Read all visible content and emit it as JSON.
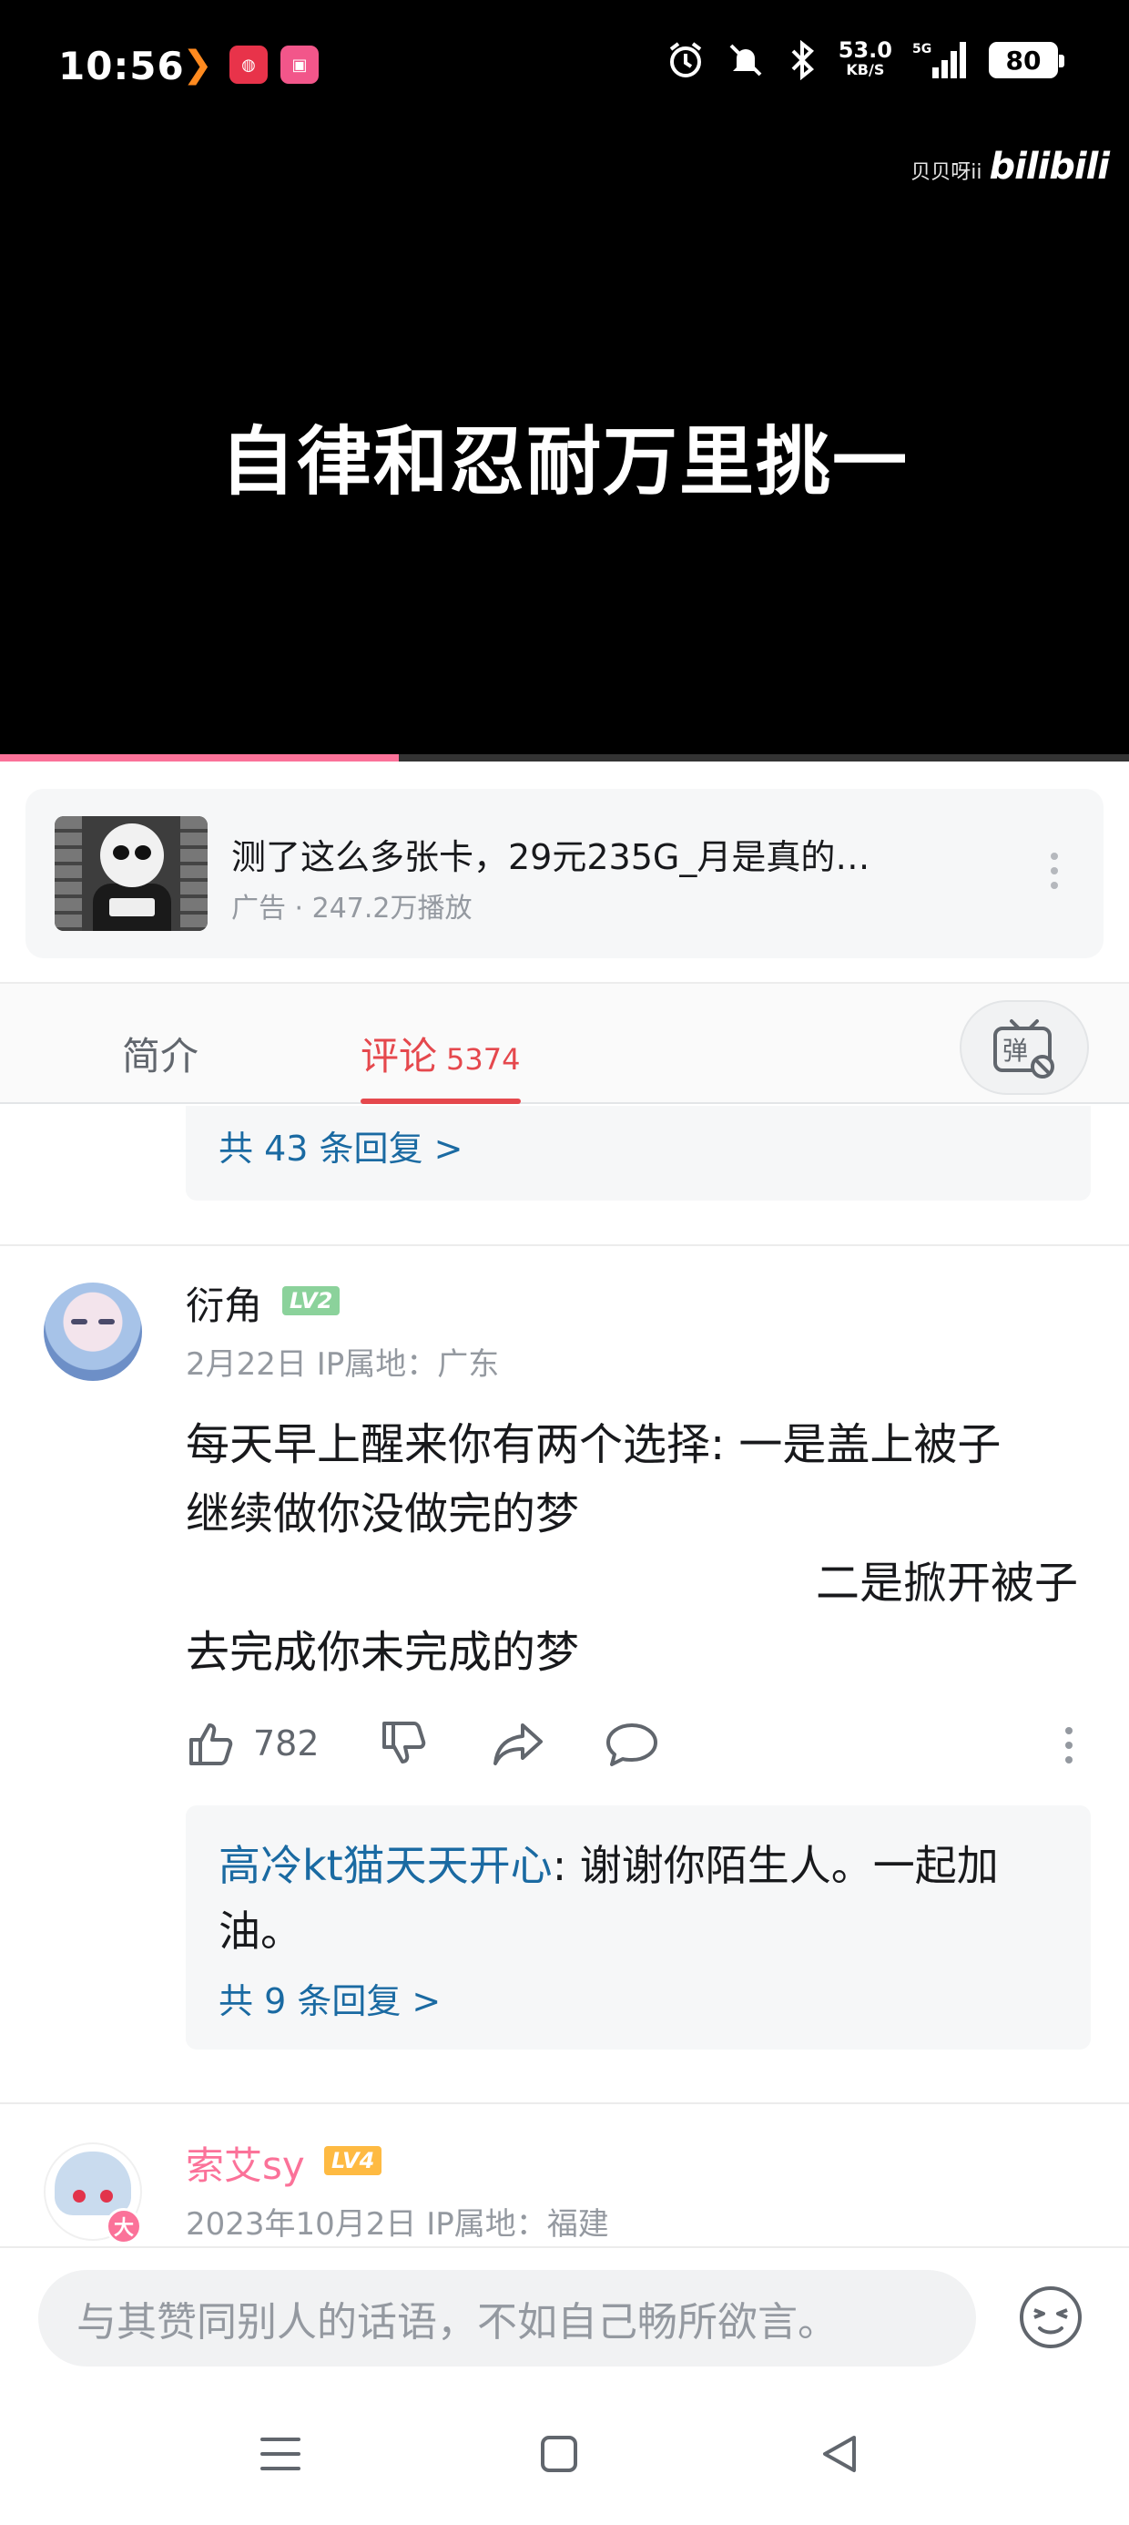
{
  "status_bar": {
    "time": "10:56",
    "net_speed_value": "53.0",
    "net_speed_unit": "KB/S",
    "network": "5G",
    "battery": "80",
    "icons": [
      "alarm-icon",
      "mute-icon",
      "bluetooth-icon",
      "signal-icon",
      "battery-icon"
    ]
  },
  "video": {
    "subtitle": "自律和忍耐万里挑一",
    "watermark_user": "贝贝呀ii",
    "watermark_logo": "bilibili",
    "progress": 0.353
  },
  "ad": {
    "title": "测了这么多张卡，29元235G_月是真的…",
    "meta": "广告 · 247.2万播放"
  },
  "tabs": {
    "intro": "简介",
    "comments": "评论",
    "comments_count": "5374"
  },
  "feed": {
    "prev_reply_more": "共 43 条回复 >",
    "comment1": {
      "username": "衍角",
      "level": "LV2",
      "meta": "2月22日 IP属地：广东",
      "lines": [
        "每天早上醒来你有两个选择: 一是盖上被子",
        "继续做你没做完的梦",
        "二是掀开被子",
        "去完成你未完成的梦"
      ],
      "likes": "782",
      "reply": {
        "user": "高冷kt猫天天开心",
        "text": ": 谢谢你陌生人。一起加油。",
        "more": "共 9 条回复 >"
      }
    },
    "comment2": {
      "username": "索艾sy",
      "level": "LV4",
      "badge": "大",
      "meta": "2023年10月2日 IP属地：福建"
    }
  },
  "input": {
    "placeholder": "与其赞同别人的话语，不如自己畅所欲言。"
  },
  "colors": {
    "accent": "#fb7299",
    "tab_active": "#e5484d",
    "link": "#1a6aa2"
  }
}
